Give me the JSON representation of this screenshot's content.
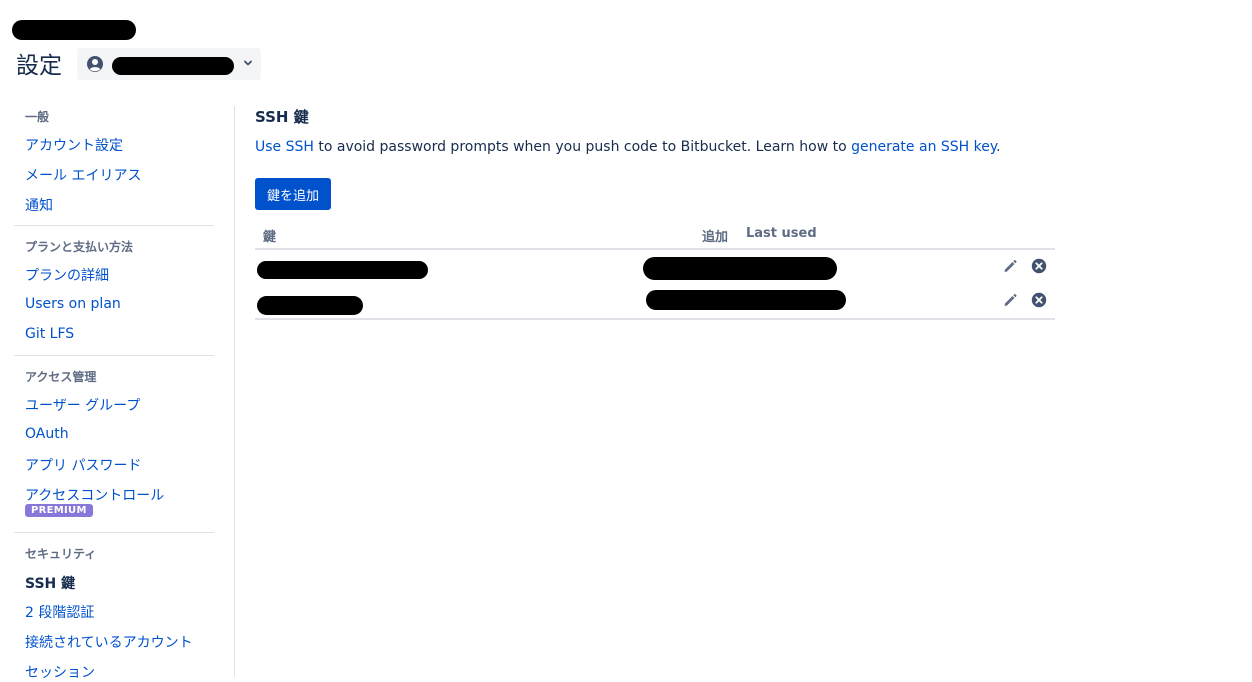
{
  "header": {
    "title": "設定",
    "account_icon": "user-avatar-icon",
    "dropdown_icon": "chevron-down-icon"
  },
  "sidebar": {
    "sections": [
      {
        "heading": "一般",
        "items": [
          "アカウント設定",
          "メール エイリアス",
          "通知"
        ]
      },
      {
        "heading": "プランと支払い方法",
        "items": [
          "プランの詳細",
          "Users on plan",
          "Git LFS"
        ]
      },
      {
        "heading": "アクセス管理",
        "items": [
          "ユーザー グループ",
          "OAuth",
          "アプリ パスワード",
          "アクセスコントロール"
        ],
        "badge": "PREMIUM"
      },
      {
        "heading": "セキュリティ",
        "items": [
          "SSH 鍵",
          "2 段階認証",
          "接続されているアカウント",
          "セッション"
        ],
        "active": "SSH 鍵"
      }
    ]
  },
  "main": {
    "title": "SSH 鍵",
    "description": {
      "link1": "Use SSH",
      "text1": " to avoid password prompts when you push code to Bitbucket. Learn how to ",
      "link2": "generate an SSH key",
      "text2": "."
    },
    "add_button": "鍵を追加",
    "table": {
      "headers": {
        "key": "鍵",
        "added": "追加",
        "last_used": "Last used"
      },
      "row_actions": [
        "edit-pencil-icon",
        "delete-x-icon"
      ]
    }
  },
  "colors": {
    "link": "#0052cc",
    "text": "#172b4d",
    "muted": "#5e6c84",
    "primary_button": "#0052cc",
    "premium_badge": "#8777d9",
    "divider": "#dfe1e6",
    "redaction": "#000000"
  }
}
